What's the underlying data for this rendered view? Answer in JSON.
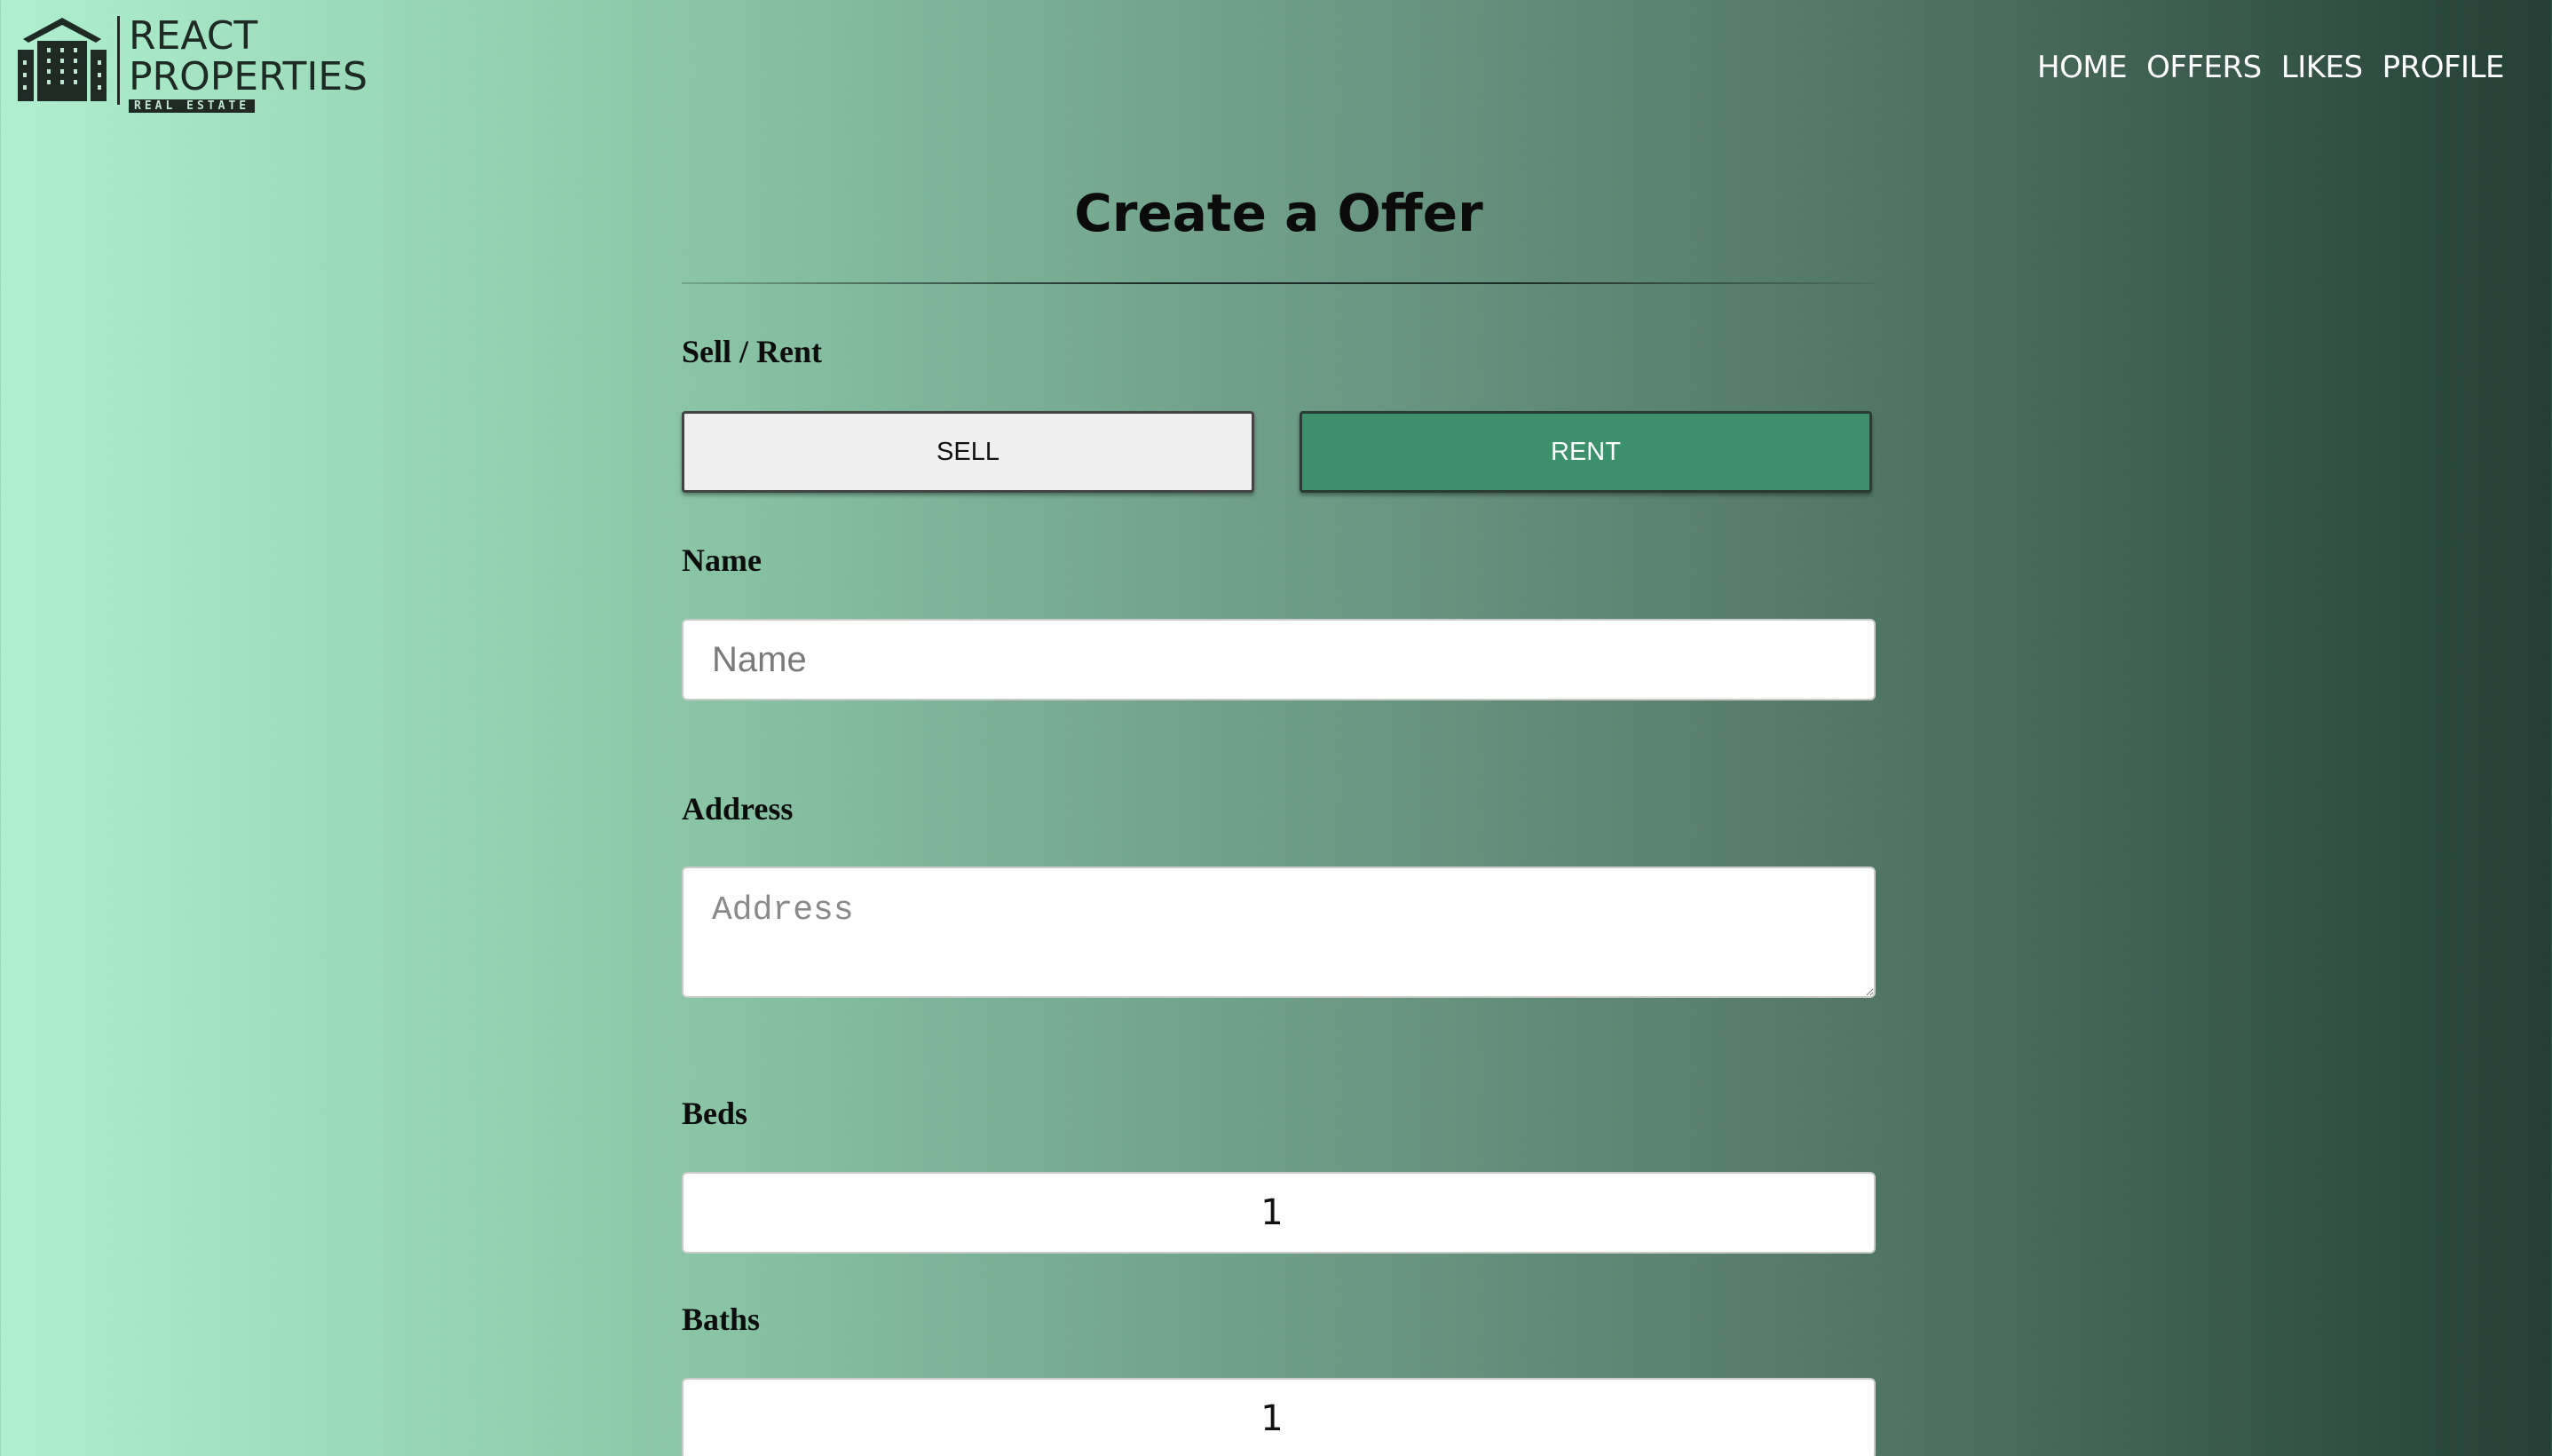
{
  "brand": {
    "line1": "REACT",
    "line2": "PROPERTIES",
    "tagline": "REAL ESTATE"
  },
  "nav": {
    "home": "HOME",
    "offers": "OFFERS",
    "likes": "LIKES",
    "profile": "PROFILE"
  },
  "page": {
    "title": "Create a Offer"
  },
  "form": {
    "type_label": "Sell / Rent",
    "sell_label": "SELL",
    "rent_label": "RENT",
    "selected_type": "rent",
    "name_label": "Name",
    "name_placeholder": "Name",
    "name_value": "",
    "address_label": "Address",
    "address_placeholder": "Address",
    "address_value": "",
    "beds_label": "Beds",
    "beds_value": "1",
    "baths_label": "Baths",
    "baths_value": "1"
  },
  "colors": {
    "accent": "#3d906c",
    "gradient_start": "#aef0cf",
    "gradient_end": "#243f35"
  }
}
